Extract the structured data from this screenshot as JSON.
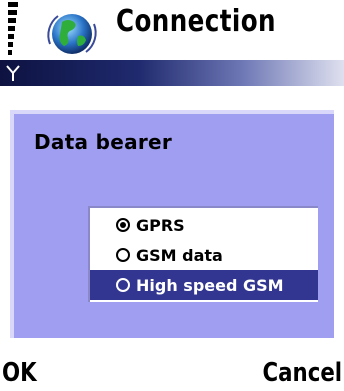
{
  "window": {
    "title": "Connection",
    "icon": "globe-icon",
    "signal_icon": "signal-strength-icon"
  },
  "dialog": {
    "heading": "Data bearer",
    "options": [
      {
        "label": "GPRS",
        "selected": true,
        "highlighted": false
      },
      {
        "label": "GSM data",
        "selected": false,
        "highlighted": false
      },
      {
        "label": "High speed GSM",
        "selected": false,
        "highlighted": true
      }
    ]
  },
  "softkeys": {
    "left": "OK",
    "right": "Cancel"
  },
  "colors": {
    "dialog_background": "#a09ef0",
    "highlight": "#323690",
    "title_strip_dark": "#0d1240"
  }
}
